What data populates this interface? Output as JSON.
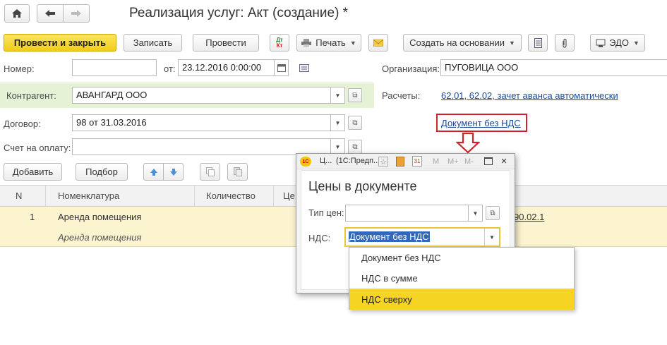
{
  "window": {
    "title": "Реализация услуг: Акт (создание) *"
  },
  "toolbar": {
    "post_close": "Провести и закрыть",
    "save": "Записать",
    "post": "Провести",
    "print": "Печать",
    "create_based": "Создать на основании",
    "edo": "ЭДО"
  },
  "form": {
    "number_label": "Номер:",
    "number_value": "",
    "date_label": "от:",
    "date_value": "23.12.2016  0:00:00",
    "org_label": "Организация:",
    "org_value": "ПУГОВИЦА ООО",
    "counterparty_label": "Контрагент:",
    "counterparty_value": "АВАНГАРД ООО",
    "settlements_label": "Расчеты:",
    "settlements_link": "62.01, 62.02, зачет аванса автоматически",
    "contract_label": "Договор:",
    "contract_value": "98 от 31.03.2016",
    "vat_link": "Документ без НДС",
    "invoice_label": "Счет на оплату:",
    "invoice_value": ""
  },
  "table_toolbar": {
    "add": "Добавить",
    "pick": "Подбор"
  },
  "table": {
    "columns": [
      "N",
      "Номенклатура",
      "Количество",
      "Це"
    ],
    "rows": [
      {
        "n": "1",
        "item": "Аренда помещения",
        "item_sub": "Аренда помещения",
        "account_fragment": "90.02.1"
      }
    ]
  },
  "dialog": {
    "title_prefix": "Ц...",
    "title_app": "(1С:Предп...",
    "calc_labels": [
      "M",
      "M+",
      "M-"
    ],
    "heading": "Цены в документе",
    "price_type_label": "Тип цен:",
    "price_type_value": "",
    "vat_label": "НДС:",
    "vat_value": "Документ без НДС",
    "options": [
      "Документ без НДС",
      "НДС в сумме",
      "НДС сверху"
    ],
    "highlighted_option": 2
  },
  "colors": {
    "accent_yellow": "#f5d423",
    "row_highlight": "#fdf7d2",
    "link": "#1a4a99",
    "callout_red": "#d3232a",
    "green_field_bg": "#e8f4d8"
  }
}
